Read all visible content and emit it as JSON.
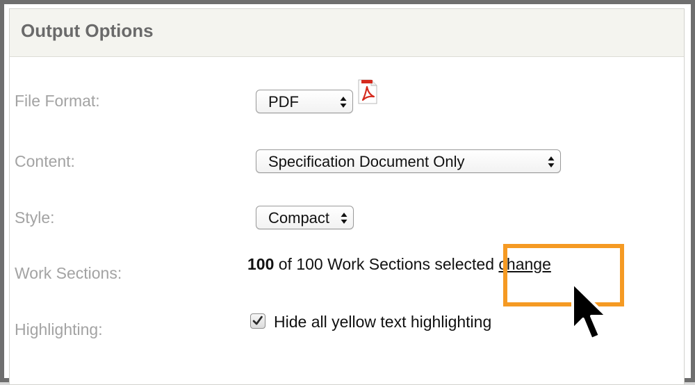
{
  "panel": {
    "title": "Output Options"
  },
  "rows": {
    "file_format": {
      "label": "File Format:",
      "selected": "PDF",
      "icon": "pdf-file-icon"
    },
    "content": {
      "label": "Content:",
      "selected": "Specification Document Only"
    },
    "style": {
      "label": "Style:",
      "selected": "Compact"
    },
    "work_sections": {
      "label": "Work Sections:",
      "selected_count": "100",
      "summary": " of 100 Work Sections selected ",
      "change_link": "change"
    },
    "highlighting": {
      "label": "Highlighting:",
      "checkbox_checked": true,
      "checkbox_label": "Hide all yellow text highlighting"
    }
  },
  "annotation": {
    "highlight_color": "#f59a23",
    "cursor": "mouse-pointer-icon"
  },
  "colors": {
    "label_gray": "#a3a3a3",
    "header_bg": "#f4f4ef",
    "pdf_red": "#d52b1e"
  }
}
